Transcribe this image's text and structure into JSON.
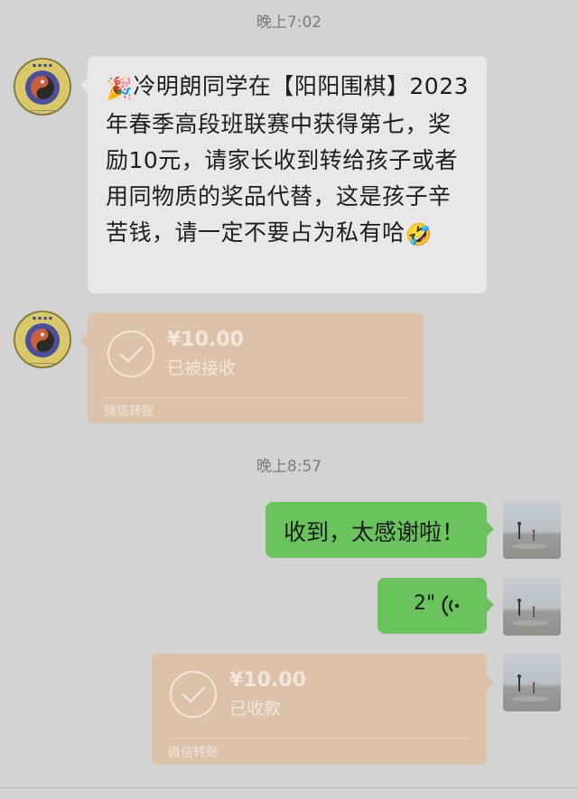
{
  "timestamps": {
    "first": "晚上7:02",
    "second": "晚上8:57"
  },
  "incoming": {
    "emoji_start": "🎉",
    "text": "冷明朗同学在【阳阳围棋】2023年春季高段班联赛中获得第七，奖励10元，请家长收到转给孩子或者用同物质的奖品代替，这是孩子辛苦钱，请一定不要占为私有哈",
    "emoji_end": "🤣",
    "transfer": {
      "amount": "¥10.00",
      "status": "已被接收",
      "footer": "微信转账"
    }
  },
  "outgoing": {
    "text_message": "收到，太感谢啦！",
    "voice_duration": "2\"",
    "transfer": {
      "amount": "¥10.00",
      "status": "已收款",
      "footer": "微信转账"
    }
  },
  "icons": {
    "org_avatar": "go-school-logo-icon",
    "user_avatar": "beach-photo-icon",
    "voice": "voice-wave-icon",
    "transfer_check": "check-circle-icon"
  },
  "colors": {
    "background": "#d3d3d3",
    "incoming_bubble": "#e8e8e8",
    "outgoing_bubble": "#6ac35c",
    "transfer_card": "#ddc2aa"
  }
}
